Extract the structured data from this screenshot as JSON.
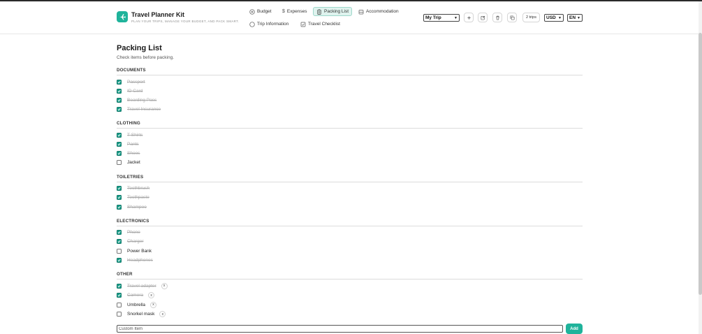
{
  "app": {
    "title": "Travel Planner Kit",
    "tagline": "PLAN YOUR TRIPS, MANAGE YOUR BUDGET, AND PACK SMART.",
    "accent_color": "#1fb39b"
  },
  "nav": {
    "budget": "Budget",
    "expenses": "Expenses",
    "packing": "Packing List",
    "accommodation": "Accommodation",
    "trip_info": "Trip Information",
    "checklist": "Travel Checklist"
  },
  "toolbar": {
    "trip_select": "My Trip",
    "trip_count": "2 trips",
    "currency": "USD",
    "language": "EN"
  },
  "page": {
    "title": "Packing List",
    "subtitle": "Check items before packing."
  },
  "sections": {
    "documents": {
      "title": "DOCUMENTS",
      "items": [
        {
          "label": "Passport",
          "checked": true
        },
        {
          "label": "ID Card",
          "checked": true
        },
        {
          "label": "Boarding Pass",
          "checked": true
        },
        {
          "label": "Travel Insurance",
          "checked": true
        }
      ]
    },
    "clothing": {
      "title": "CLOTHING",
      "items": [
        {
          "label": "T-Shirts",
          "checked": true
        },
        {
          "label": "Pants",
          "checked": true
        },
        {
          "label": "Shoes",
          "checked": true
        },
        {
          "label": "Jacket",
          "checked": false
        }
      ]
    },
    "toiletries": {
      "title": "TOILETRIES",
      "items": [
        {
          "label": "Toothbrush",
          "checked": true
        },
        {
          "label": "Toothpaste",
          "checked": true
        },
        {
          "label": "Shampoo",
          "checked": true
        }
      ]
    },
    "electronics": {
      "title": "ELECTRONICS",
      "items": [
        {
          "label": "Phone",
          "checked": true
        },
        {
          "label": "Charger",
          "checked": true
        },
        {
          "label": "Power Bank",
          "checked": false
        },
        {
          "label": "Headphones",
          "checked": true
        }
      ]
    },
    "other": {
      "title": "OTHER",
      "remove_glyph": "x",
      "items": [
        {
          "label": "Travel adapter",
          "checked": true
        },
        {
          "label": "Camera",
          "checked": true
        },
        {
          "label": "Umbrella",
          "checked": false
        },
        {
          "label": "Snorkel mask",
          "checked": false
        }
      ]
    }
  },
  "add_form": {
    "placeholder": "Custom Item",
    "button_label": "Add"
  },
  "icons": {
    "logo": "plane-icon",
    "budget": "plus-circle-icon",
    "expenses": "dollar-icon",
    "packing": "clipboard-icon",
    "accommodation": "bed-icon",
    "trip_info": "info-circle-icon",
    "checklist": "checkbox-icon",
    "add": "plus-icon",
    "edit": "edit-icon",
    "delete": "trash-icon",
    "duplicate": "copy-icon"
  }
}
